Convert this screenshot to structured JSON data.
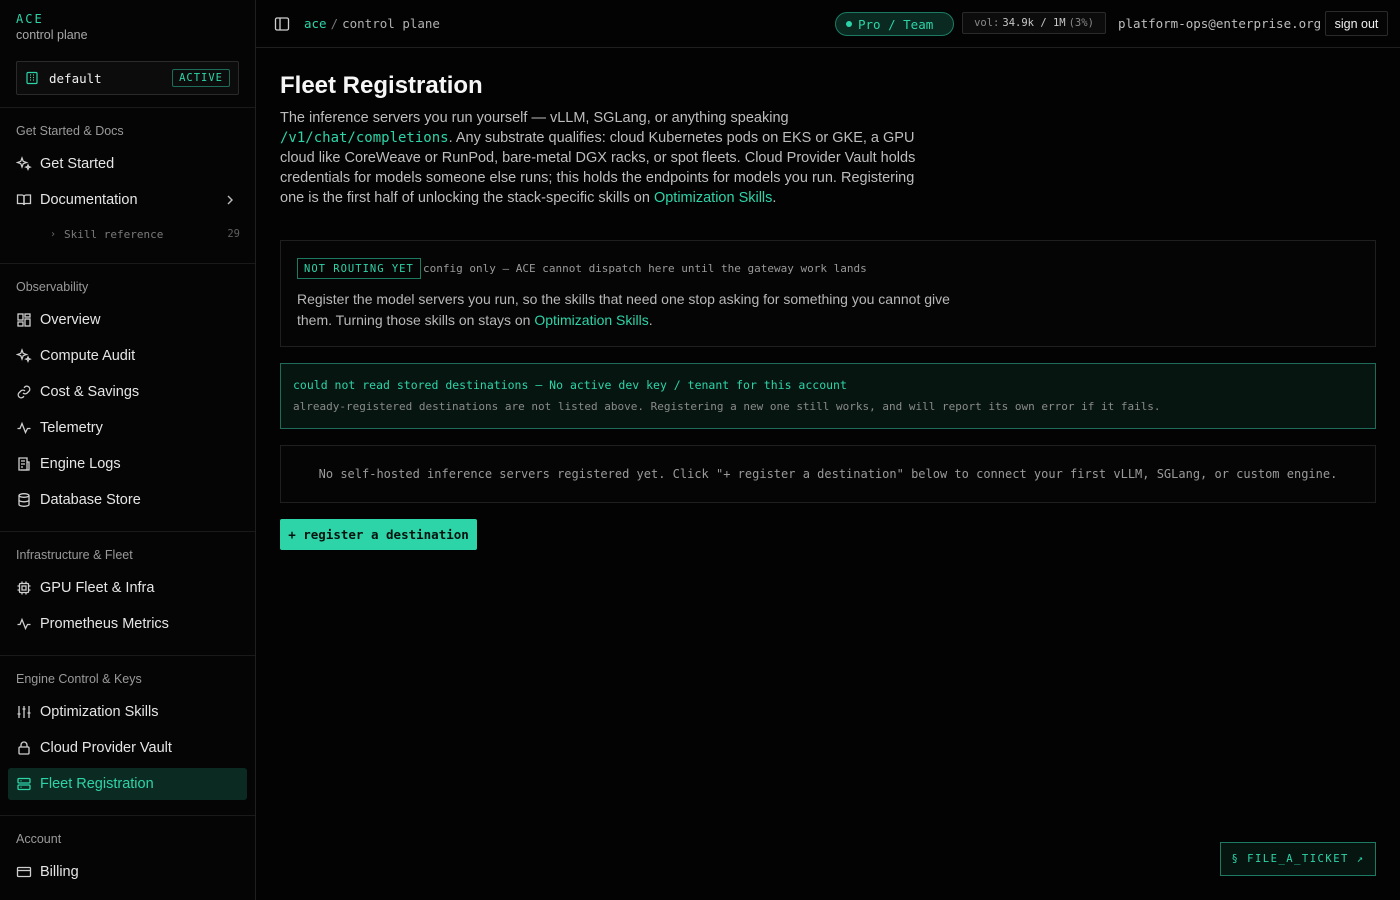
{
  "brand": {
    "name": "ACE",
    "subtitle": "control plane"
  },
  "org": {
    "name": "default",
    "badge": "ACTIVE"
  },
  "sidebar": {
    "sections": [
      {
        "title": "Get Started & Docs"
      },
      {
        "title": "Observability"
      },
      {
        "title": "Infrastructure & Fleet"
      },
      {
        "title": "Engine Control & Keys"
      },
      {
        "title": "Account"
      }
    ],
    "items": {
      "get_started": "Get Started",
      "documentation": "Documentation",
      "skill_reference": "Skill reference",
      "skill_reference_count": "29",
      "overview": "Overview",
      "compute_audit": "Compute Audit",
      "cost_savings": "Cost & Savings",
      "telemetry": "Telemetry",
      "engine_logs": "Engine Logs",
      "database_store": "Database Store",
      "gpu_fleet": "GPU Fleet & Infra",
      "prometheus": "Prometheus Metrics",
      "optimization_skills": "Optimization Skills",
      "cloud_vault": "Cloud Provider Vault",
      "fleet_registration": "Fleet Registration",
      "billing": "Billing"
    }
  },
  "topbar": {
    "crumb_root": "ace",
    "crumb_sep": "/",
    "crumb_page": "control plane",
    "plan": "Pro / Team",
    "vol_label": "vol:",
    "vol_value": "34.9k / 1M",
    "vol_pct": "(3%)",
    "email": "platform-ops@enterprise.org",
    "signout": "sign out"
  },
  "main": {
    "title": "Fleet Registration",
    "intro_1": "The inference servers you run yourself — vLLM, SGLang, or anything speaking ",
    "intro_code": "/v1/chat/completions",
    "intro_2": ". Any substrate qualifies: cloud Kubernetes pods on EKS or GKE, a GPU cloud like CoreWeave or RunPod, bare-metal DGX racks, or spot fleets. Cloud Provider Vault holds credentials for models someone else runs; this holds the endpoints for models you run. Registering one is the first half of unlocking the stack-specific skills on ",
    "intro_link": "Optimization Skills",
    "intro_3": ".",
    "notice_tag": "NOT ROUTING YET",
    "notice_note": "config only — ACE cannot dispatch here until the gateway work lands",
    "notice_body_1": "Register the model servers you run, so the skills that need one stop asking for something you cannot give them. Turning those skills on stays on ",
    "notice_link": "Optimization Skills",
    "notice_body_2": ".",
    "error_title": "could not read stored destinations — No active dev key / tenant for this account",
    "error_sub": "already-registered destinations are not listed above. Registering a new one still works, and will report its own error if it fails.",
    "empty_state": "No self-hosted inference servers registered yet. Click \"+ register a destination\" below to connect your first vLLM, SGLang, or custom engine.",
    "register_button": "+ register a destination",
    "ticket_button": "§ FILE_A_TICKET ↗"
  },
  "colors": {
    "accent": "#2dd4a8",
    "background": "#030303",
    "active_bg": "#0b2a22"
  }
}
